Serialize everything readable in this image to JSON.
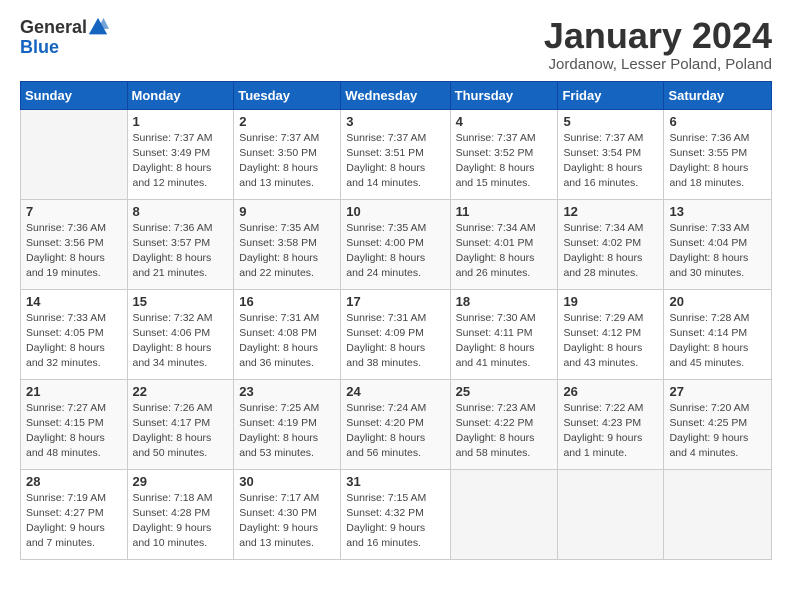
{
  "header": {
    "logo_general": "General",
    "logo_blue": "Blue",
    "month_title": "January 2024",
    "location": "Jordanow, Lesser Poland, Poland"
  },
  "days_of_week": [
    "Sunday",
    "Monday",
    "Tuesday",
    "Wednesday",
    "Thursday",
    "Friday",
    "Saturday"
  ],
  "weeks": [
    [
      {
        "day": "",
        "info": ""
      },
      {
        "day": "1",
        "info": "Sunrise: 7:37 AM\nSunset: 3:49 PM\nDaylight: 8 hours\nand 12 minutes."
      },
      {
        "day": "2",
        "info": "Sunrise: 7:37 AM\nSunset: 3:50 PM\nDaylight: 8 hours\nand 13 minutes."
      },
      {
        "day": "3",
        "info": "Sunrise: 7:37 AM\nSunset: 3:51 PM\nDaylight: 8 hours\nand 14 minutes."
      },
      {
        "day": "4",
        "info": "Sunrise: 7:37 AM\nSunset: 3:52 PM\nDaylight: 8 hours\nand 15 minutes."
      },
      {
        "day": "5",
        "info": "Sunrise: 7:37 AM\nSunset: 3:54 PM\nDaylight: 8 hours\nand 16 minutes."
      },
      {
        "day": "6",
        "info": "Sunrise: 7:36 AM\nSunset: 3:55 PM\nDaylight: 8 hours\nand 18 minutes."
      }
    ],
    [
      {
        "day": "7",
        "info": "Sunrise: 7:36 AM\nSunset: 3:56 PM\nDaylight: 8 hours\nand 19 minutes."
      },
      {
        "day": "8",
        "info": "Sunrise: 7:36 AM\nSunset: 3:57 PM\nDaylight: 8 hours\nand 21 minutes."
      },
      {
        "day": "9",
        "info": "Sunrise: 7:35 AM\nSunset: 3:58 PM\nDaylight: 8 hours\nand 22 minutes."
      },
      {
        "day": "10",
        "info": "Sunrise: 7:35 AM\nSunset: 4:00 PM\nDaylight: 8 hours\nand 24 minutes."
      },
      {
        "day": "11",
        "info": "Sunrise: 7:34 AM\nSunset: 4:01 PM\nDaylight: 8 hours\nand 26 minutes."
      },
      {
        "day": "12",
        "info": "Sunrise: 7:34 AM\nSunset: 4:02 PM\nDaylight: 8 hours\nand 28 minutes."
      },
      {
        "day": "13",
        "info": "Sunrise: 7:33 AM\nSunset: 4:04 PM\nDaylight: 8 hours\nand 30 minutes."
      }
    ],
    [
      {
        "day": "14",
        "info": "Sunrise: 7:33 AM\nSunset: 4:05 PM\nDaylight: 8 hours\nand 32 minutes."
      },
      {
        "day": "15",
        "info": "Sunrise: 7:32 AM\nSunset: 4:06 PM\nDaylight: 8 hours\nand 34 minutes."
      },
      {
        "day": "16",
        "info": "Sunrise: 7:31 AM\nSunset: 4:08 PM\nDaylight: 8 hours\nand 36 minutes."
      },
      {
        "day": "17",
        "info": "Sunrise: 7:31 AM\nSunset: 4:09 PM\nDaylight: 8 hours\nand 38 minutes."
      },
      {
        "day": "18",
        "info": "Sunrise: 7:30 AM\nSunset: 4:11 PM\nDaylight: 8 hours\nand 41 minutes."
      },
      {
        "day": "19",
        "info": "Sunrise: 7:29 AM\nSunset: 4:12 PM\nDaylight: 8 hours\nand 43 minutes."
      },
      {
        "day": "20",
        "info": "Sunrise: 7:28 AM\nSunset: 4:14 PM\nDaylight: 8 hours\nand 45 minutes."
      }
    ],
    [
      {
        "day": "21",
        "info": "Sunrise: 7:27 AM\nSunset: 4:15 PM\nDaylight: 8 hours\nand 48 minutes."
      },
      {
        "day": "22",
        "info": "Sunrise: 7:26 AM\nSunset: 4:17 PM\nDaylight: 8 hours\nand 50 minutes."
      },
      {
        "day": "23",
        "info": "Sunrise: 7:25 AM\nSunset: 4:19 PM\nDaylight: 8 hours\nand 53 minutes."
      },
      {
        "day": "24",
        "info": "Sunrise: 7:24 AM\nSunset: 4:20 PM\nDaylight: 8 hours\nand 56 minutes."
      },
      {
        "day": "25",
        "info": "Sunrise: 7:23 AM\nSunset: 4:22 PM\nDaylight: 8 hours\nand 58 minutes."
      },
      {
        "day": "26",
        "info": "Sunrise: 7:22 AM\nSunset: 4:23 PM\nDaylight: 9 hours\nand 1 minute."
      },
      {
        "day": "27",
        "info": "Sunrise: 7:20 AM\nSunset: 4:25 PM\nDaylight: 9 hours\nand 4 minutes."
      }
    ],
    [
      {
        "day": "28",
        "info": "Sunrise: 7:19 AM\nSunset: 4:27 PM\nDaylight: 9 hours\nand 7 minutes."
      },
      {
        "day": "29",
        "info": "Sunrise: 7:18 AM\nSunset: 4:28 PM\nDaylight: 9 hours\nand 10 minutes."
      },
      {
        "day": "30",
        "info": "Sunrise: 7:17 AM\nSunset: 4:30 PM\nDaylight: 9 hours\nand 13 minutes."
      },
      {
        "day": "31",
        "info": "Sunrise: 7:15 AM\nSunset: 4:32 PM\nDaylight: 9 hours\nand 16 minutes."
      },
      {
        "day": "",
        "info": ""
      },
      {
        "day": "",
        "info": ""
      },
      {
        "day": "",
        "info": ""
      }
    ]
  ]
}
